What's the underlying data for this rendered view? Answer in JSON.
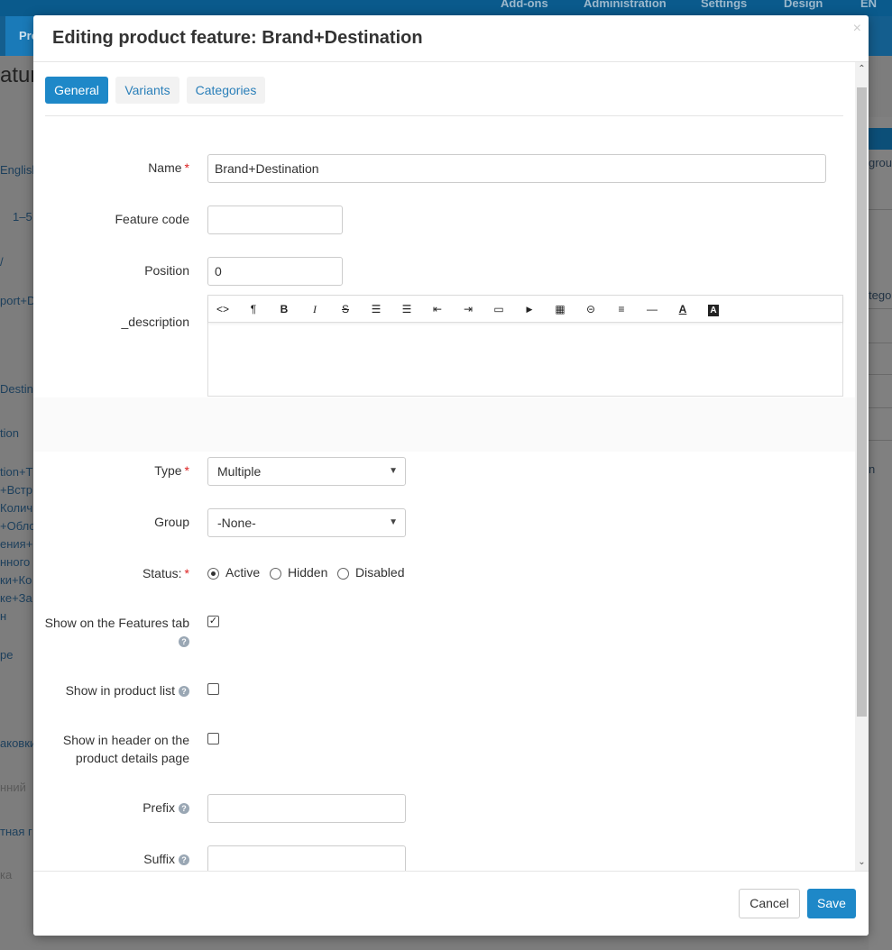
{
  "background": {
    "top_menu": [
      "Add-ons",
      "Administration",
      "Settings",
      "Design",
      "EN"
    ],
    "active_nav_tab": "Pro",
    "page_title": "ature",
    "left_column": [
      "English",
      "1–5",
      "/",
      "port+D",
      "Destin",
      "tion",
      "tion+T",
      "+Встр",
      "Колич",
      "+Обло",
      "ения+",
      "нного",
      "ки+Ко",
      "ке+За",
      "н",
      "pe",
      "аковки",
      "нний",
      "тная г",
      "ка"
    ],
    "right_column": [
      "grou",
      "tego",
      "n"
    ]
  },
  "modal": {
    "title": "Editing product feature: Brand+Destination",
    "close_label": "×",
    "tabs": {
      "general": "General",
      "variants": "Variants",
      "categories": "Categories"
    },
    "fields": {
      "name": {
        "label": "Name",
        "value": "Brand+Destination"
      },
      "feature_code": {
        "label": "Feature code",
        "value": ""
      },
      "position": {
        "label": "Position",
        "value": "0"
      },
      "description": {
        "label": "_description",
        "value": ""
      },
      "type": {
        "label": "Type",
        "value": "Multiple"
      },
      "group": {
        "label": "Group",
        "value": "-None-"
      },
      "status": {
        "label": "Status:",
        "options": [
          "Active",
          "Hidden",
          "Disabled"
        ],
        "selected": "Active"
      },
      "show_on_features_tab": {
        "label": "Show on the Features tab",
        "checked": true
      },
      "show_in_product_list": {
        "label": "Show in product list",
        "checked": false
      },
      "show_in_header": {
        "label_line1": "Show in header on the",
        "label_line2": "product details page",
        "checked": false
      },
      "prefix": {
        "label": "Prefix",
        "value": ""
      },
      "suffix": {
        "label": "Suffix",
        "value": ""
      }
    },
    "required_mark": "*",
    "help_glyph": "?",
    "editor_toolbar": [
      {
        "name": "html-icon",
        "glyph": "<>"
      },
      {
        "name": "paragraph-icon",
        "glyph": "¶"
      },
      {
        "name": "bold-icon",
        "glyph": "B"
      },
      {
        "name": "italic-icon",
        "glyph": "I"
      },
      {
        "name": "strikethrough-icon",
        "glyph": "S"
      },
      {
        "name": "unordered-list-icon",
        "glyph": "☰"
      },
      {
        "name": "ordered-list-icon",
        "glyph": "☰"
      },
      {
        "name": "outdent-icon",
        "glyph": "⇤"
      },
      {
        "name": "indent-icon",
        "glyph": "⇥"
      },
      {
        "name": "image-icon",
        "glyph": "▭"
      },
      {
        "name": "video-icon",
        "glyph": "▶"
      },
      {
        "name": "table-icon",
        "glyph": "▦"
      },
      {
        "name": "link-icon",
        "glyph": "⊝"
      },
      {
        "name": "align-icon",
        "glyph": "≡"
      },
      {
        "name": "horizontal-rule-icon",
        "glyph": "—"
      },
      {
        "name": "font-color-icon",
        "glyph": "A"
      },
      {
        "name": "background-color-icon",
        "glyph": "A"
      }
    ],
    "footer": {
      "cancel": "Cancel",
      "save": "Save"
    }
  },
  "colors": {
    "primary": "#1e88c8",
    "link": "#2a7fb9",
    "required": "#dd2222"
  }
}
